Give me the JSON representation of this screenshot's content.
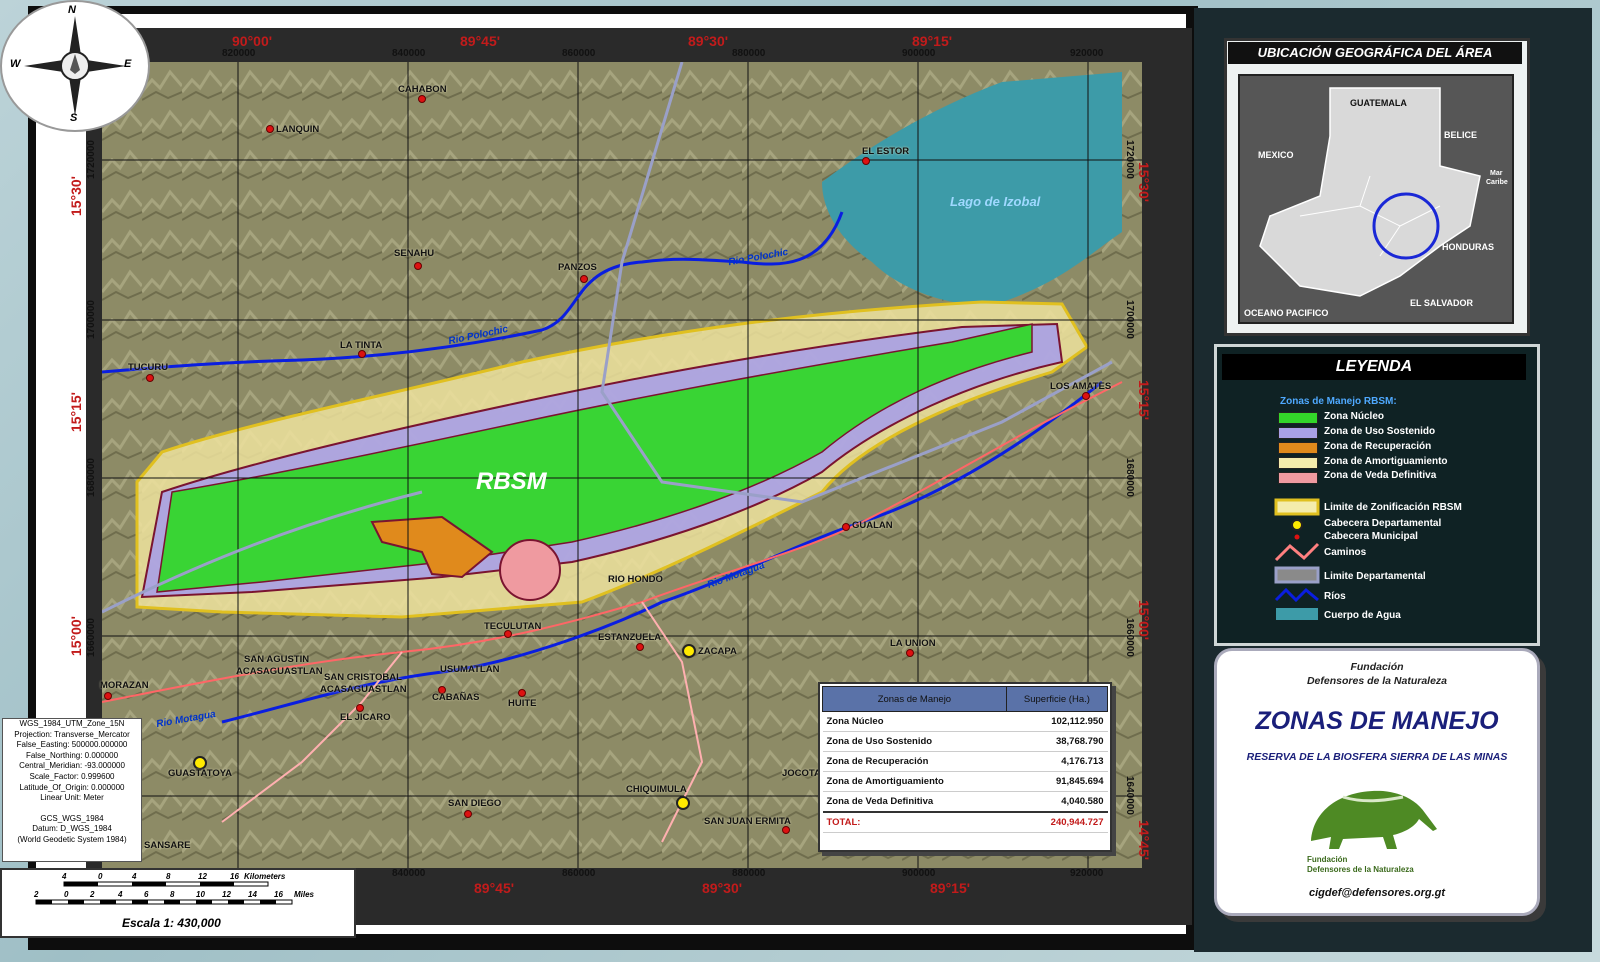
{
  "map": {
    "top_coords": [
      "90°00'",
      "89°45'",
      "89°30'",
      "89°15'"
    ],
    "bottom_coords": [
      "89°45'",
      "89°30'",
      "89°15'"
    ],
    "left_coords": [
      "15°30'",
      "15°15'",
      "15°00'"
    ],
    "right_coords": [
      "15°30'",
      "15°15'",
      "15°00'",
      "14°45'"
    ],
    "eastings": [
      "820000",
      "840000",
      "860000",
      "880000",
      "900000",
      "920000"
    ],
    "northings": [
      "1720000",
      "1700000",
      "1680000",
      "1660000",
      "1640000"
    ],
    "zone_label": "RBSM",
    "lake_label": "Lago de Izobal",
    "rivers": [
      "Rio Polochic",
      "Rio Polochic",
      "Rio Motagua",
      "Rio Motagua"
    ],
    "towns": {
      "cahabon": "CAHABON",
      "lanquin": "LANQUIN",
      "el_estor": "EL ESTOR",
      "senahu": "SENAHU",
      "panzos": "PANZOS",
      "la_tinta": "LA TINTA",
      "tucuru": "TUCURU",
      "los_amates": "LOS AMATES",
      "gualan": "GUALAN",
      "rio_hondo": "RIO HONDO",
      "teculutan": "TECULUTAN",
      "estanzuela": "ESTANZUELA",
      "zacapa": "ZACAPA",
      "la_union": "LA UNION",
      "san_agustin": "SAN AGUSTIN",
      "acasaguastlan1": "ACASAGUASTLAN",
      "san_cristobal": "SAN CRISTOBAL",
      "acasaguastlan2": "ACASAGUASTLAN",
      "usumatlan": "USUMATLAN",
      "morazan": "MORAZAN",
      "cabanas": "CABAÑAS",
      "huite": "HUITE",
      "el_jicaro": "EL JICARO",
      "guastatoya": "GUASTATOYA",
      "jocotan": "JOCOTA",
      "chiquimula": "CHIQUIMULA",
      "san_diego": "SAN DIEGO",
      "san_juan_ermita": "SAN JUAN ERMITA",
      "sansare": "SANSARE"
    }
  },
  "compass": {
    "n": "N",
    "s": "S",
    "e": "E",
    "w": "W"
  },
  "inset": {
    "title": "UBICACIÓN GEOGRÁFICA DEL ÁREA",
    "labels": {
      "guatemala": "GUATEMALA",
      "mexico": "MEXICO",
      "belice": "BELICE",
      "mar_caribe1": "Mar",
      "mar_caribe2": "Caribe",
      "honduras": "HONDURAS",
      "el_salvador": "EL SALVADOR",
      "oceano": "OCEANO PACIFICO"
    }
  },
  "legend": {
    "title": "LEYENDA",
    "heading": "Zonas de Manejo RBSM:",
    "zones": [
      {
        "label": "Zona Núcleo",
        "color": "#33d62a"
      },
      {
        "label": "Zona de Uso Sostenido",
        "color": "#a9a0e6"
      },
      {
        "label": "Zona de Recuperación",
        "color": "#e08a1c"
      },
      {
        "label": "Zona de Amortiguamiento",
        "color": "#f4ecac"
      },
      {
        "label": "Zona de Veda Definitiva",
        "color": "#ef9aa0"
      }
    ],
    "symbols": [
      "Limite de Zonificación RBSM",
      "Cabecera Departamental",
      "Cabecera Municipal",
      "Caminos",
      "Limite Departamental",
      "Ríos",
      "Cuerpo de Agua"
    ]
  },
  "table": {
    "headers": [
      "Zonas de Manejo",
      "Superficie (Ha.)"
    ],
    "rows": [
      {
        "zone": "Zona Núcleo",
        "area": "102,112.950"
      },
      {
        "zone": "Zona de Uso Sostenido",
        "area": "38,768.790"
      },
      {
        "zone": "Zona de Recuperación",
        "area": "4,176.713"
      },
      {
        "zone": "Zona de Amortiguamiento",
        "area": "91,845.694"
      },
      {
        "zone": "Zona de Veda Definitiva",
        "area": "4,040.580"
      }
    ],
    "total_label": "TOTAL:",
    "total_value": "240,944.727"
  },
  "title_block": {
    "org_line1": "Fundación",
    "org_line2": "Defensores de la Naturaleza",
    "main_title": "ZONAS DE MANEJO",
    "subtitle": "RESERVA DE LA BIOSFERA SIERRA DE LAS MINAS",
    "logo_line1": "Fundación",
    "logo_line2": "Defensores de la Naturaleza",
    "email": "cigdef@defensores.org.gt"
  },
  "projection": [
    "WGS_1984_UTM_Zone_15N",
    "Projection: Transverse_Mercator",
    "False_Easting: 500000.000000",
    "False_Northing: 0.000000",
    "Central_Meridian: -93.000000",
    "Scale_Factor: 0.999600",
    "Latitude_Of_Origin: 0.000000",
    "Linear Unit: Meter",
    "",
    "GCS_WGS_1984",
    "Datum: D_WGS_1984",
    "(World Geodetic System 1984)"
  ],
  "scale": {
    "km_ticks": [
      "4",
      "0",
      "4",
      "8",
      "12",
      "16"
    ],
    "km_unit": "Kilometers",
    "mi_ticks": [
      "2",
      "0",
      "2",
      "4",
      "6",
      "8",
      "10",
      "12",
      "14",
      "16"
    ],
    "mi_unit": "Miles",
    "title": "Escala 1: 430,000"
  }
}
